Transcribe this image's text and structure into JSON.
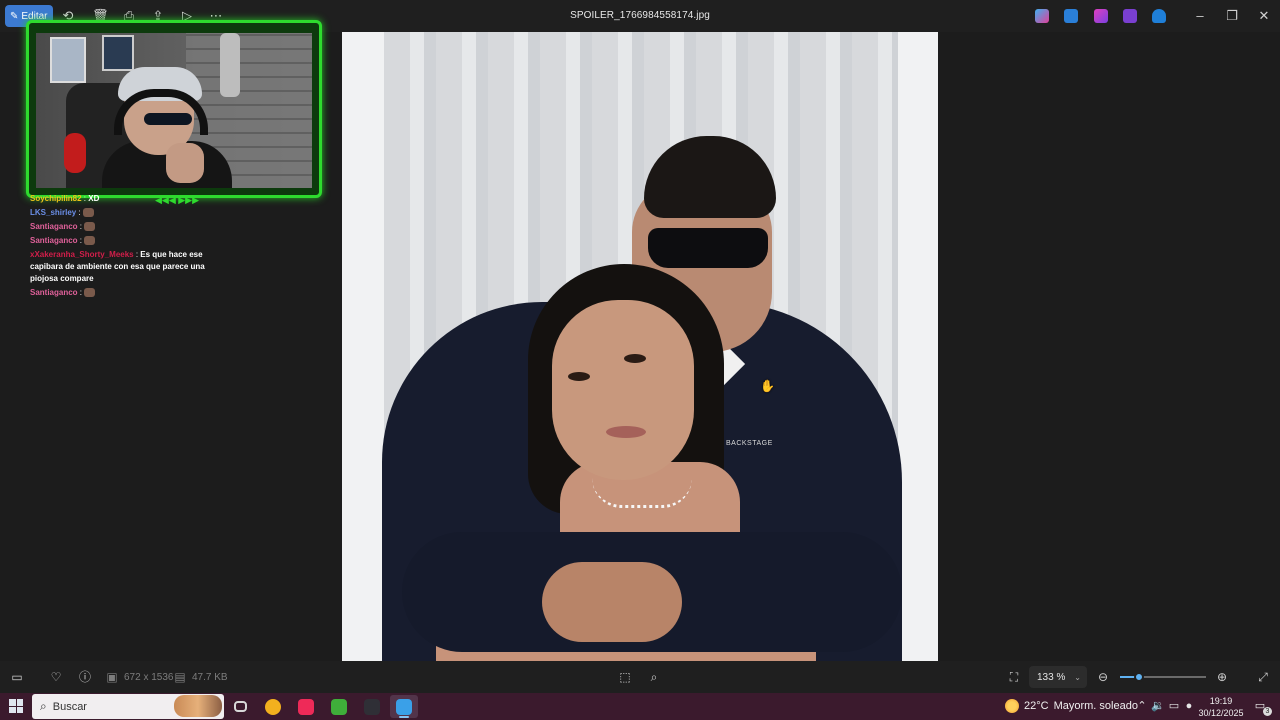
{
  "titlebar": {
    "file_name": "SPOILER_1766984558174.jpg",
    "edit_label": "Editar"
  },
  "overlay": {
    "chat": [
      {
        "user": "Soychipilin82",
        "message": "XD",
        "color": "#f0c419"
      },
      {
        "user": "LKS_shirley",
        "message": "",
        "color": "#6b8fe8"
      },
      {
        "user": "Santiaganco",
        "message": "",
        "color": "#e0619a"
      },
      {
        "user": "Santiaganco",
        "message": "",
        "color": "#e0619a"
      },
      {
        "user": "xXakeranha_Shorty_Meeks",
        "message": "Es que hace ese capibara de ambiente con esa que parece una piojosa compare",
        "color": "#d11e4a"
      },
      {
        "user": "Santiaganco",
        "message": "",
        "color": "#e0619a"
      }
    ],
    "frame_color": "#2edb2e"
  },
  "photo": {
    "logo_text": "BACKSTAGE"
  },
  "viewer_bar": {
    "dimensions": "672 x 1536",
    "file_size": "47.7 KB",
    "zoom": "133 %",
    "zoom_fraction": 0.22
  },
  "taskbar": {
    "search_label": "Buscar",
    "weather_temp": "22°C",
    "weather_text": "Mayorm. soleado",
    "time": "19:19",
    "date": "30/12/2025",
    "notifications": "3",
    "apps": [
      {
        "name": "task-view",
        "color": "#d8d8d8",
        "active": false
      },
      {
        "name": "chrome",
        "color": "#f2b01e",
        "active": false
      },
      {
        "name": "tiktok",
        "color": "#ee2a58",
        "active": false
      },
      {
        "name": "minecraft",
        "color": "#3fae3a",
        "active": false
      },
      {
        "name": "obs",
        "color": "#2f2f36",
        "active": false
      },
      {
        "name": "photos",
        "color": "#3aa0e8",
        "active": true
      }
    ]
  },
  "colors": {
    "accent": "#3c7ad1",
    "zoom_accent": "#5fb2f2",
    "taskbar": "#3b1a2d"
  }
}
